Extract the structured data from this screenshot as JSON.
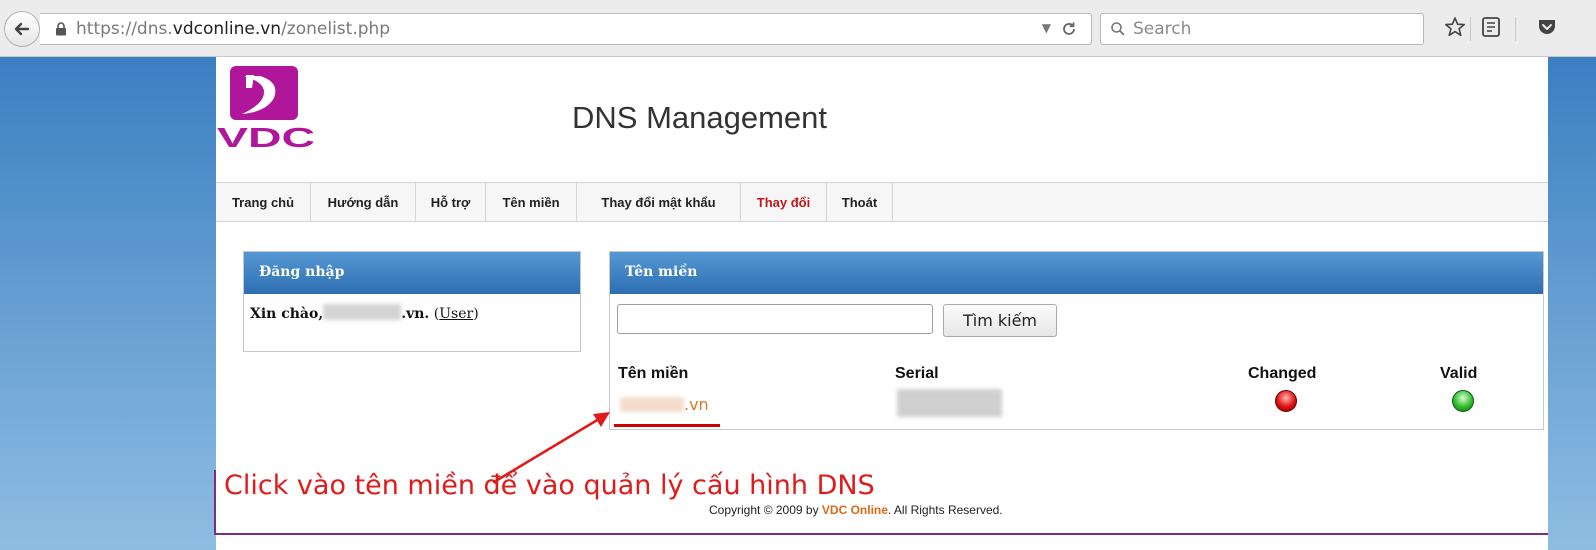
{
  "browser": {
    "url_prefix": "https://dns.",
    "url_host": "vdconline.vn",
    "url_path": "/zonelist.php",
    "search_placeholder": "Search"
  },
  "header": {
    "logo_text": "VDC",
    "title": "DNS Management",
    "brand_color": "#b0169a"
  },
  "nav": {
    "items": [
      "Trang chủ",
      "Hướng dẫn",
      "Hỗ trợ",
      "Tên miền",
      "Thay đổi mật khẩu",
      "Thay đổi",
      "Thoát"
    ],
    "active_item": "Thay đổi",
    "active_color": "#c0181a"
  },
  "login_panel": {
    "title": "Đăng nhập",
    "greeting": "Xin chào,",
    "domain_suffix": ".vn.",
    "open_paren": "(",
    "role_link": "User",
    "close_paren": ")"
  },
  "domain_panel": {
    "title": "Tên miền",
    "search_value": "",
    "search_button": "Tìm kiếm",
    "columns": [
      "Tên miền",
      "Serial",
      "Changed",
      "Valid"
    ],
    "rows": [
      {
        "domain_suffix": ".vn",
        "changed_status": "red",
        "valid_status": "green"
      }
    ]
  },
  "annotation": {
    "text": "Click vào tên miền để vào quản lý cấu hình DNS",
    "color": "#e01b1b"
  },
  "footer": {
    "prefix": "Copyright © 2009 by ",
    "brand": "VDC Online",
    "suffix": ". All Rights Reserved."
  }
}
